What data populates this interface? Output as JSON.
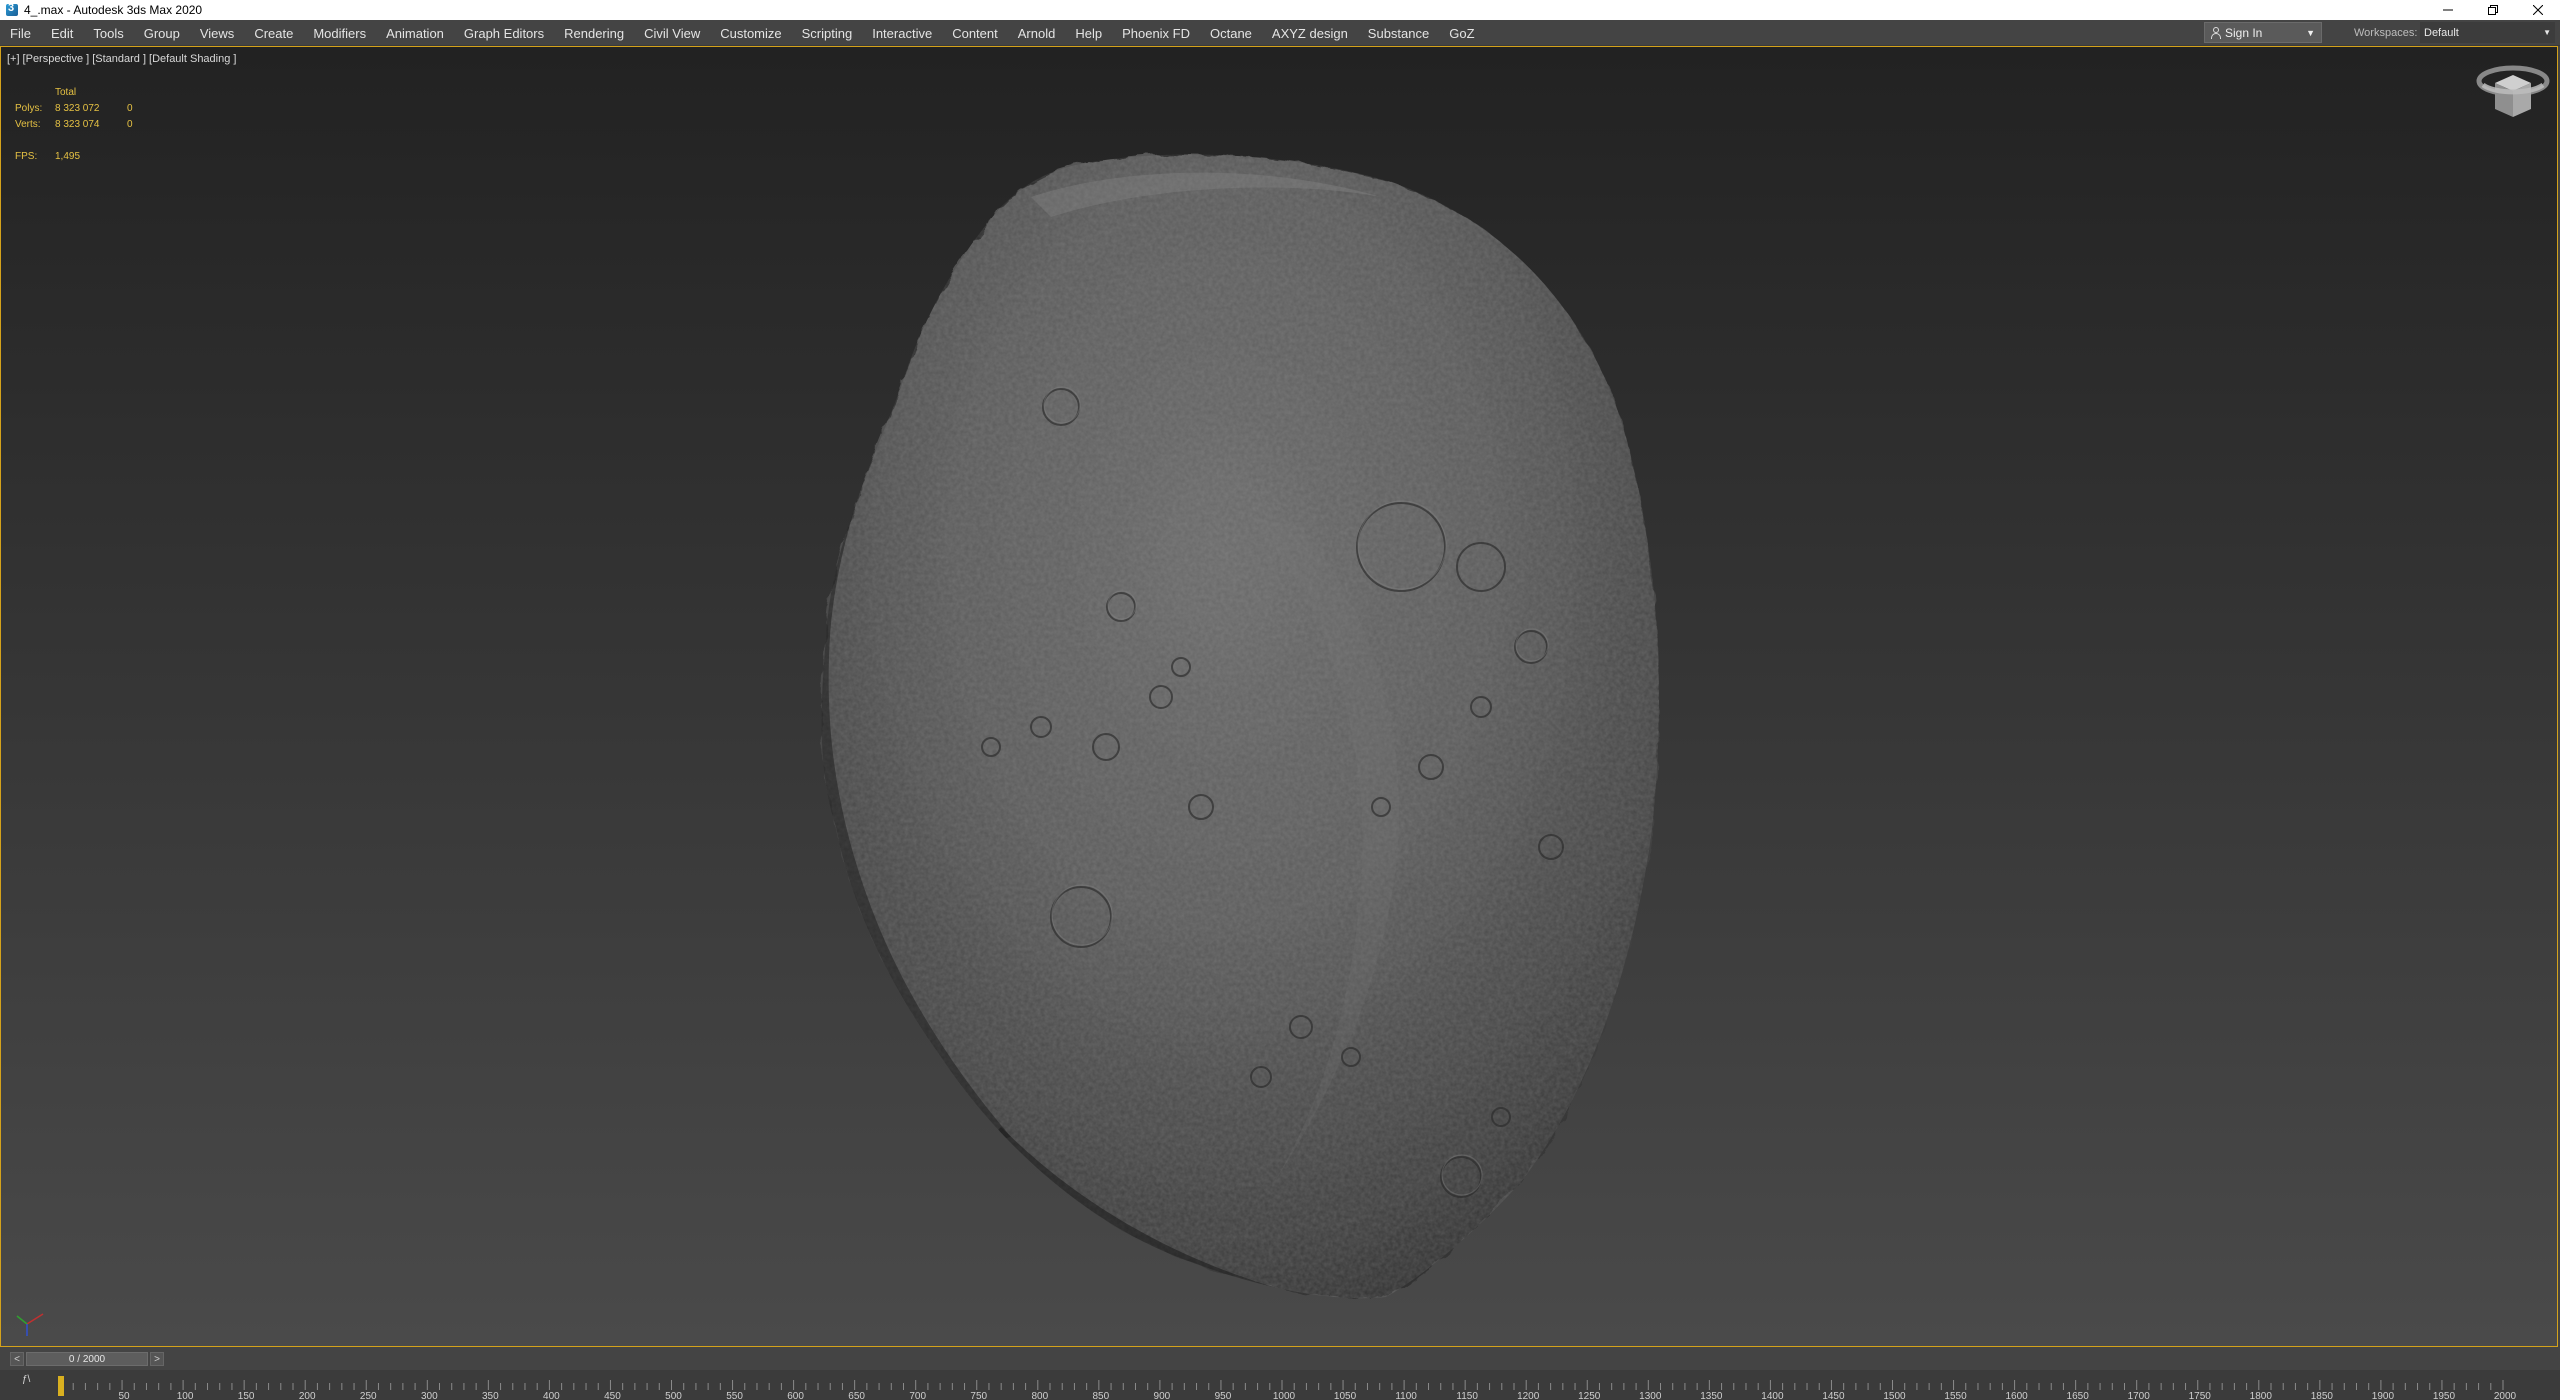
{
  "window": {
    "title": "4_.max - Autodesk 3ds Max 2020",
    "minimize_icon": "minimize-icon",
    "restore_icon": "restore-icon",
    "close_icon": "close-icon"
  },
  "menubar": {
    "items": [
      "File",
      "Edit",
      "Tools",
      "Group",
      "Views",
      "Create",
      "Modifiers",
      "Animation",
      "Graph Editors",
      "Rendering",
      "Civil View",
      "Customize",
      "Scripting",
      "Interactive",
      "Content",
      "Arnold",
      "Help",
      "Phoenix FD",
      "Octane",
      "AXYZ design",
      "Substance",
      "GoZ"
    ],
    "signin_label": "Sign In",
    "workspaces_label": "Workspaces:",
    "workspace_value": "Default"
  },
  "viewport": {
    "labels": [
      "[+]",
      "[Perspective ]",
      "[Standard ]",
      "[Default Shading ]"
    ],
    "stats": {
      "header": "Total",
      "polys_label": "Polys:",
      "polys_value": "8 323 072",
      "polys_sel": "0",
      "verts_label": "Verts:",
      "verts_value": "8 323 074",
      "verts_sel": "0",
      "fps_label": "FPS:",
      "fps_value": "1,495"
    },
    "accent_border": "#d4a21b"
  },
  "timeslider": {
    "position_label": "0 / 2000",
    "prev": "<",
    "next": ">"
  },
  "trackbar": {
    "key_icon": "key-filter-icon",
    "ticks": [
      "50",
      "100",
      "150",
      "200",
      "250",
      "300",
      "350",
      "400",
      "450",
      "500",
      "550",
      "600",
      "650",
      "700",
      "750",
      "800",
      "850",
      "900",
      "950",
      "1000",
      "1050",
      "1100",
      "1150",
      "1200",
      "1250",
      "1300",
      "1350",
      "1400",
      "1450",
      "1500",
      "1550",
      "1600",
      "1650",
      "1700",
      "1750",
      "1800",
      "1850",
      "1900",
      "1950",
      "2000"
    ]
  }
}
